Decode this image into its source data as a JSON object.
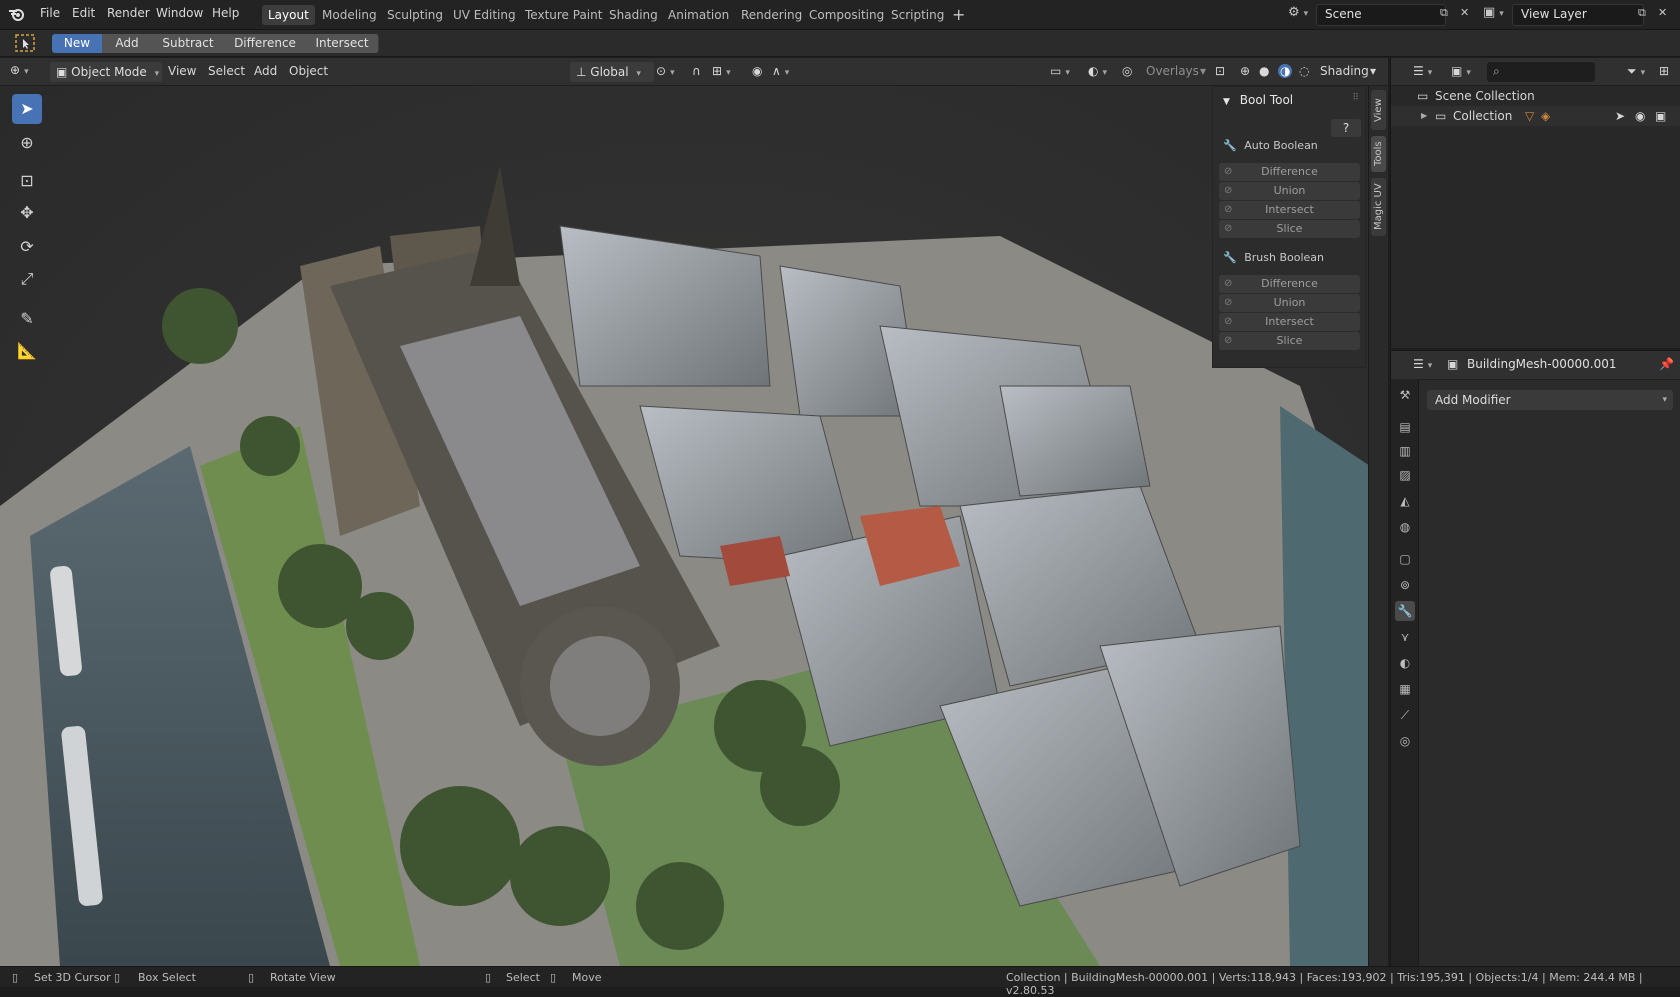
{
  "menu": {
    "items": [
      "File",
      "Edit",
      "Render",
      "Window",
      "Help"
    ]
  },
  "workspaces": [
    "Layout",
    "Modeling",
    "Sculpting",
    "UV Editing",
    "Texture Paint",
    "Shading",
    "Animation",
    "Rendering",
    "Compositing",
    "Scripting"
  ],
  "active_workspace": "Layout",
  "scene": {
    "name": "Scene",
    "view_layer": "View Layer"
  },
  "bool_bar": {
    "buttons": [
      "New",
      "Add",
      "Subtract",
      "Difference",
      "Intersect"
    ],
    "active": "New"
  },
  "viewport_header": {
    "mode": "Object Mode",
    "menus": [
      "View",
      "Select",
      "Add",
      "Object"
    ],
    "orientation": "Global",
    "overlays": "Overlays",
    "shading": "Shading"
  },
  "bool_tool": {
    "title": "Bool Tool",
    "auto_label": "Auto Boolean",
    "auto_buttons": [
      "Difference",
      "Union",
      "Intersect",
      "Slice"
    ],
    "brush_label": "Brush Boolean",
    "brush_buttons": [
      "Difference",
      "Union",
      "Intersect",
      "Slice"
    ]
  },
  "side_tabs": [
    "View",
    "Tools",
    "Magic UV"
  ],
  "outliner": {
    "scene_collection": "Scene Collection",
    "collection": "Collection"
  },
  "properties": {
    "object_name": "BuildingMesh-00000.001",
    "add_modifier": "Add Modifier"
  },
  "statusbar": {
    "set_cursor": "Set 3D Cursor",
    "box_select": "Box Select",
    "rotate_view": "Rotate View",
    "select": "Select",
    "move": "Move",
    "info": "Collection | BuildingMesh-00000.001 | Verts:118,943 | Faces:193,902 | Tris:195,391 | Objects:1/4 | Mem: 244.4 MB | v2.80.53"
  },
  "colors": {
    "accent": "#4772b3",
    "bg": "#2b2b2b"
  }
}
